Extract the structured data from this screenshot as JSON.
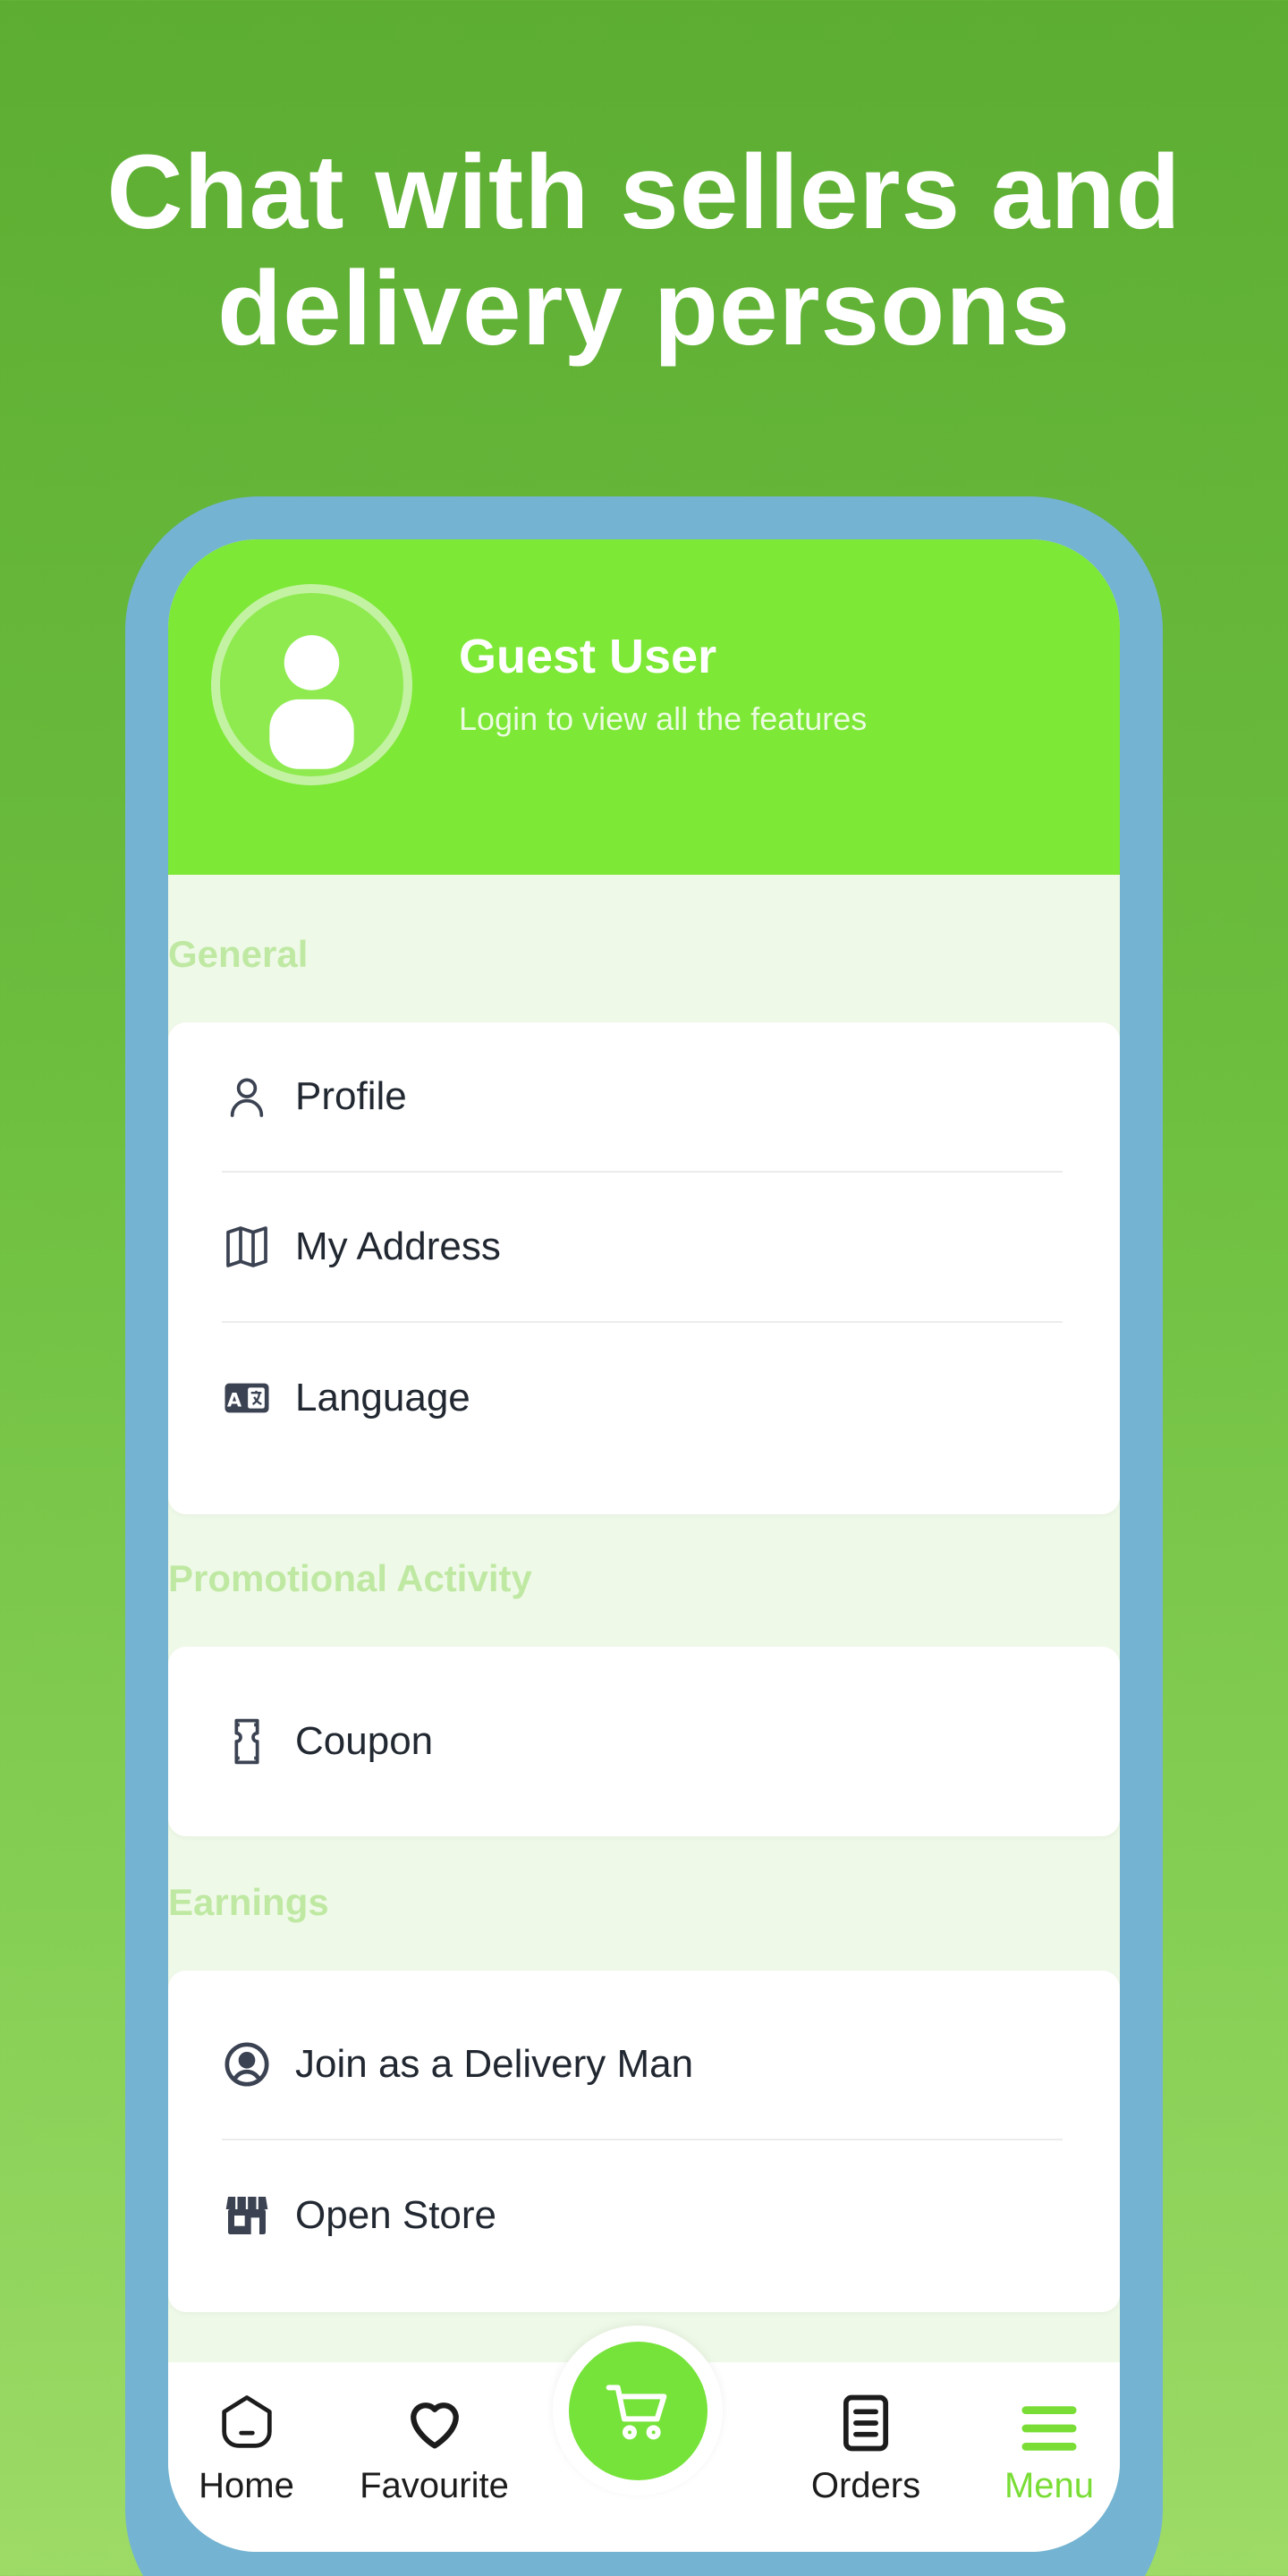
{
  "headline": {
    "line1": "Chat with sellers and",
    "line2": "delivery persons"
  },
  "header": {
    "user_name": "Guest User",
    "user_subtitle": "Login to view all the features"
  },
  "sections": {
    "general": {
      "title": "General",
      "items": [
        {
          "label": "Profile",
          "icon": "person-icon"
        },
        {
          "label": "My Address",
          "icon": "map-icon"
        },
        {
          "label": "Language",
          "icon": "translate-icon"
        }
      ]
    },
    "promotional": {
      "title": "Promotional Activity",
      "items": [
        {
          "label": "Coupon",
          "icon": "coupon-icon"
        }
      ]
    },
    "earnings": {
      "title": "Earnings",
      "items": [
        {
          "label": "Join as a Delivery Man",
          "icon": "user-circle-icon"
        },
        {
          "label": "Open Store",
          "icon": "store-icon"
        }
      ]
    }
  },
  "bottom_nav": {
    "home": "Home",
    "favourite": "Favourite",
    "orders": "Orders",
    "menu": "Menu",
    "active": "menu"
  },
  "colors": {
    "brand_green": "#7de835",
    "frame_blue": "#74b3d2",
    "section_title": "#bfe9a3"
  }
}
